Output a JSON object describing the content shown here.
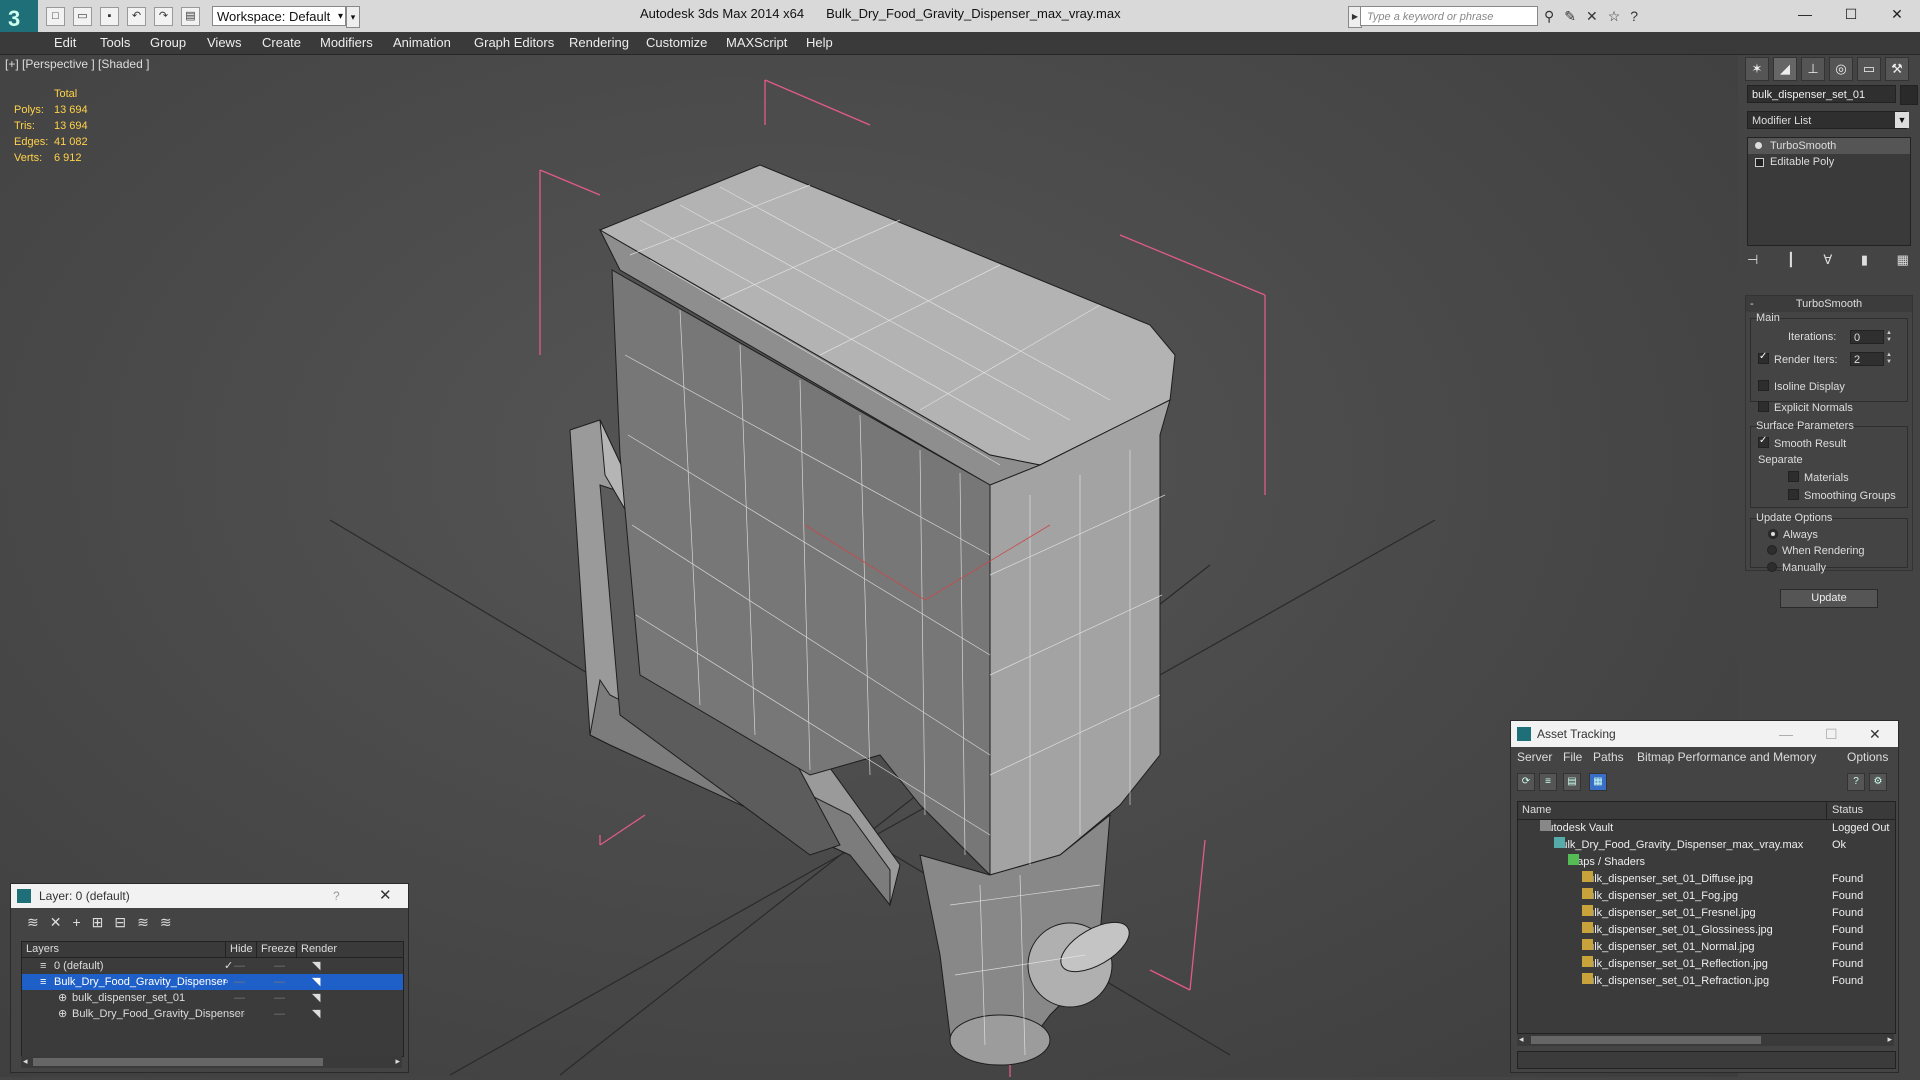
{
  "app": {
    "title": "Autodesk 3ds Max  2014 x64",
    "file": "Bulk_Dry_Food_Gravity_Dispenser_max_vray.max",
    "workspace": "Workspace: Default",
    "search_placeholder": "Type a keyword or phrase",
    "logo": "3"
  },
  "menu": [
    "Edit",
    "Tools",
    "Group",
    "Views",
    "Create",
    "Modifiers",
    "Animation",
    "Graph Editors",
    "Rendering",
    "Customize",
    "MAXScript",
    "Help"
  ],
  "viewport": {
    "label": "[+] [Perspective ] [Shaded ]",
    "stats": {
      "header": "Total",
      "rows": [
        {
          "label": "Polys:",
          "value": "13 694"
        },
        {
          "label": "Tris:",
          "value": "13 694"
        },
        {
          "label": "Edges:",
          "value": "41 082"
        },
        {
          "label": "Verts:",
          "value": "6 912"
        }
      ]
    }
  },
  "command_panel": {
    "object_name": "bulk_dispenser_set_01",
    "modifier_list": "Modifier List",
    "stack": [
      "TurboSmooth",
      "Editable Poly"
    ],
    "rollout_title": "TurboSmooth",
    "main_label": "Main",
    "iterations_label": "Iterations:",
    "iterations_value": "0",
    "render_iters_label": "Render Iters:",
    "render_iters_value": "2",
    "isoline": "Isoline Display",
    "explicit_normals": "Explicit Normals",
    "surface_params": "Surface Parameters",
    "smooth_result": "Smooth Result",
    "separate": "Separate",
    "materials": "Materials",
    "smoothing_groups": "Smoothing Groups",
    "update_options": "Update Options",
    "always": "Always",
    "when_rendering": "When Rendering",
    "manually": "Manually",
    "update_button": "Update"
  },
  "layer_dialog": {
    "title": "Layer: 0 (default)",
    "help": "?",
    "columns": [
      "Layers",
      "Hide",
      "Freeze",
      "Render"
    ],
    "rows": [
      {
        "name": "0 (default)",
        "indent": 1,
        "selected": false
      },
      {
        "name": "Bulk_Dry_Food_Gravity_Dispenser",
        "indent": 1,
        "selected": true
      },
      {
        "name": "bulk_dispenser_set_01",
        "indent": 2,
        "selected": false
      },
      {
        "name": "Bulk_Dry_Food_Gravity_Dispenser",
        "indent": 2,
        "selected": false
      }
    ]
  },
  "asset_tracking": {
    "title": "Asset Tracking",
    "menu": [
      "Server",
      "File",
      "Paths",
      "Bitmap Performance and Memory",
      "Options"
    ],
    "columns": [
      "Name",
      "Status"
    ],
    "rows": [
      {
        "name": "Autodesk Vault",
        "status": "Logged Out",
        "indent": 1
      },
      {
        "name": "Bulk_Dry_Food_Gravity_Dispenser_max_vray.max",
        "status": "Ok",
        "indent": 2
      },
      {
        "name": "Maps / Shaders",
        "status": "",
        "indent": 3
      },
      {
        "name": "bulk_dispenser_set_01_Diffuse.jpg",
        "status": "Found",
        "indent": 4
      },
      {
        "name": "bulk_dispenser_set_01_Fog.jpg",
        "status": "Found",
        "indent": 4
      },
      {
        "name": "bulk_dispenser_set_01_Fresnel.jpg",
        "status": "Found",
        "indent": 4
      },
      {
        "name": "bulk_dispenser_set_01_Glossiness.jpg",
        "status": "Found",
        "indent": 4
      },
      {
        "name": "bulk_dispenser_set_01_Normal.jpg",
        "status": "Found",
        "indent": 4
      },
      {
        "name": "bulk_dispenser_set_01_Reflection.jpg",
        "status": "Found",
        "indent": 4
      },
      {
        "name": "bulk_dispenser_set_01_Refraction.jpg",
        "status": "Found",
        "indent": 4
      }
    ]
  },
  "colors": {
    "selection": "#1f5fc8",
    "stats_text": "#ffd24a",
    "bbox": "#e05a8a"
  }
}
